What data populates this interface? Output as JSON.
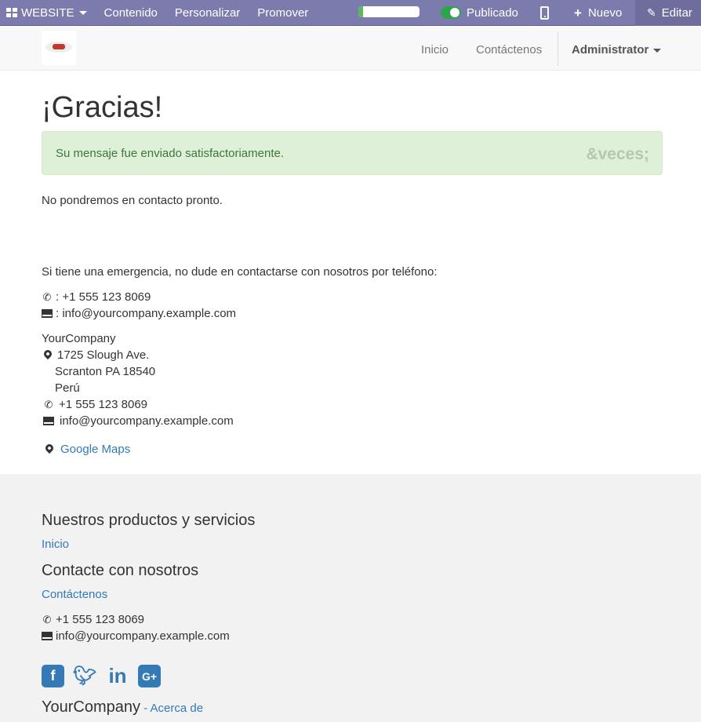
{
  "adminbar": {
    "website_label": "WEBSITE",
    "menu": [
      "Contenido",
      "Personalizar",
      "Promover"
    ],
    "progress_fraction": 0.08,
    "published_label": "Publicado",
    "new_label": "Nuevo",
    "edit_label": "Editar"
  },
  "navbar": {
    "links": [
      "Inicio",
      "Contáctenos"
    ],
    "user": "Administrator"
  },
  "page": {
    "title": "¡Gracias!",
    "alert_message": "Su mensaje fue enviado satisfactoriamente.",
    "alert_close": "&veces;",
    "contact_soon": "No pondremos en contacto pronto.",
    "emergency_text": "Si tiene una emergencia, no dude en contactarse con nosotros por teléfono:",
    "phone_line": ": +1 555 123 8069",
    "email_line": ": info@yourcompany.example.com",
    "company": "YourCompany",
    "address": [
      "1725 Slough Ave.",
      "Scranton PA 18540",
      "Perú"
    ],
    "phone": "+1 555 123 8069",
    "email": "info@yourcompany.example.com",
    "maps_label": "Google Maps"
  },
  "footer": {
    "products_heading": "Nuestros productos y servicios",
    "products_link": "Inicio",
    "contact_heading": "Contacte con nosotros",
    "contact_link": "Contáctenos",
    "phone": "+1 555 123 8069",
    "email": "info@yourcompany.example.com",
    "social_icons": [
      "facebook-icon",
      "twitter-icon",
      "linkedin-icon",
      "google-plus-icon"
    ],
    "company": "YourCompany",
    "about_link": "- Acerca de"
  },
  "colors": {
    "adminbar": "#7c7bad",
    "link": "#337ab7",
    "alert_bg": "#dff0d8",
    "alert_text": "#3c763d"
  }
}
